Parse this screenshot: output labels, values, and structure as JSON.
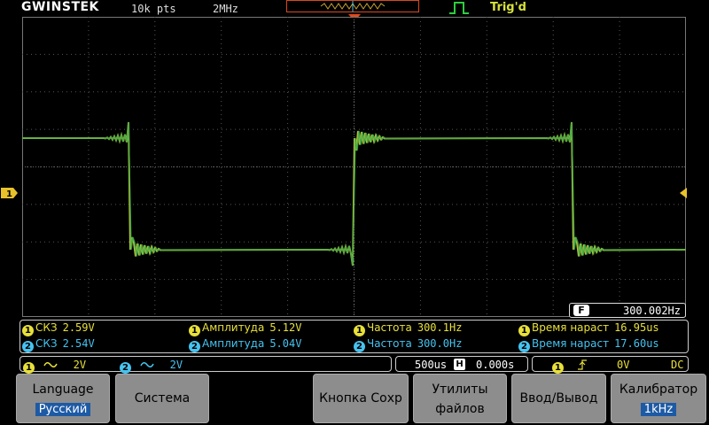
{
  "header": {
    "brand": "GWINSTEK",
    "record_length": "10k pts",
    "sample_rate": "2MHz",
    "trigger_state": "Trig'd"
  },
  "colors": {
    "ch1": "#e8e03a",
    "ch2": "#46c3f0",
    "trace_ch1": "#b8c23a",
    "trace_ch2": "#3aa848",
    "accent": "#e04a1a"
  },
  "frequency_counter": {
    "badge": "F",
    "value": "300.002Hz"
  },
  "measurements": [
    {
      "ch": "1",
      "label": "СКЗ",
      "value": "2.59V"
    },
    {
      "ch": "2",
      "label": "СКЗ",
      "value": "2.54V"
    },
    {
      "ch": "1",
      "label": "Амплитуда",
      "value": "5.12V"
    },
    {
      "ch": "2",
      "label": "Амплитуда",
      "value": "5.04V"
    },
    {
      "ch": "1",
      "label": "Частота",
      "value": "300.1Hz"
    },
    {
      "ch": "2",
      "label": "Частота",
      "value": "300.0Hz"
    },
    {
      "ch": "1",
      "label": "Время нараст",
      "value": "16.95us"
    },
    {
      "ch": "2",
      "label": "Время нараст",
      "value": "17.60us"
    }
  ],
  "status": {
    "ch1_num": "1",
    "ch1_scale": "2V",
    "ch2_num": "2",
    "ch2_scale": "2V",
    "timebase": "500us",
    "horizontal_badge": "H",
    "position": "0.000s",
    "trigger_source": "1",
    "trigger_level": "0V",
    "coupling": "DC"
  },
  "softkeys": {
    "language_label": "Language",
    "language_value": "Русский",
    "system": "Система",
    "save_key": "Кнопка Сохр",
    "file_utils_l1": "Утилиты",
    "file_utils_l2": "файлов",
    "io": "Ввод/Вывод",
    "calibrator_label": "Калибратор",
    "calibrator_value": "1kHz"
  },
  "markers": {
    "ch1_ground": "1"
  }
}
